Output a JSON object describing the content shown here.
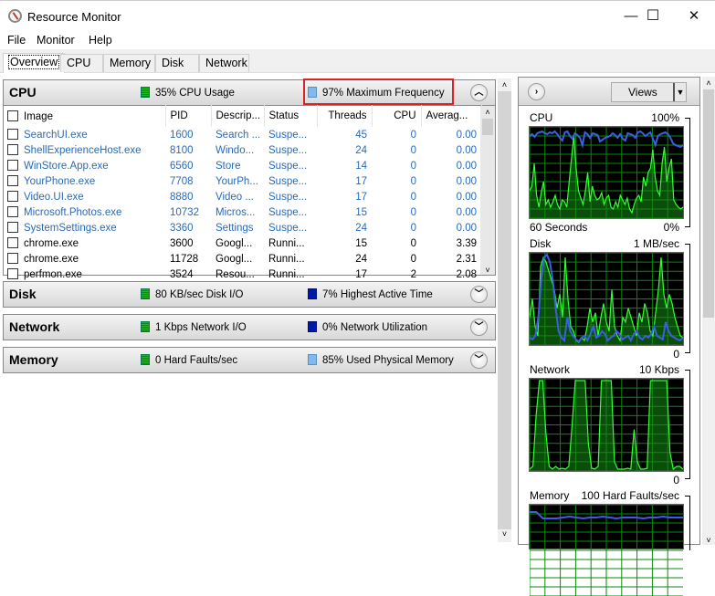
{
  "window": {
    "title": "Resource Monitor",
    "minimize": "—",
    "maximize": "☐",
    "close": "✕"
  },
  "menu": [
    "File",
    "Monitor",
    "Help"
  ],
  "tabs": [
    "Overview",
    "CPU",
    "Memory",
    "Disk",
    "Network"
  ],
  "active_tab": "Overview",
  "cpu_section": {
    "title": "CPU",
    "usage": "35% CPU Usage",
    "frequency": "97% Maximum Frequency",
    "columns": [
      "Image",
      "PID",
      "Descrip...",
      "Status",
      "Threads",
      "CPU",
      "Averag..."
    ],
    "rows": [
      {
        "image": "SearchUI.exe",
        "pid": "1600",
        "desc": "Search ...",
        "status": "Suspe...",
        "threads": "45",
        "cpu": "0",
        "avg": "0.00",
        "suspended": true
      },
      {
        "image": "ShellExperienceHost.exe",
        "pid": "8100",
        "desc": "Windo...",
        "status": "Suspe...",
        "threads": "24",
        "cpu": "0",
        "avg": "0.00",
        "suspended": true
      },
      {
        "image": "WinStore.App.exe",
        "pid": "6560",
        "desc": "Store",
        "status": "Suspe...",
        "threads": "14",
        "cpu": "0",
        "avg": "0.00",
        "suspended": true
      },
      {
        "image": "YourPhone.exe",
        "pid": "7708",
        "desc": "YourPh...",
        "status": "Suspe...",
        "threads": "17",
        "cpu": "0",
        "avg": "0.00",
        "suspended": true
      },
      {
        "image": "Video.UI.exe",
        "pid": "8880",
        "desc": "Video ...",
        "status": "Suspe...",
        "threads": "17",
        "cpu": "0",
        "avg": "0.00",
        "suspended": true
      },
      {
        "image": "Microsoft.Photos.exe",
        "pid": "10732",
        "desc": "Micros...",
        "status": "Suspe...",
        "threads": "15",
        "cpu": "0",
        "avg": "0.00",
        "suspended": true
      },
      {
        "image": "SystemSettings.exe",
        "pid": "3360",
        "desc": "Settings",
        "status": "Suspe...",
        "threads": "24",
        "cpu": "0",
        "avg": "0.00",
        "suspended": true
      },
      {
        "image": "chrome.exe",
        "pid": "3600",
        "desc": "Googl...",
        "status": "Runni...",
        "threads": "15",
        "cpu": "0",
        "avg": "3.39",
        "suspended": false
      },
      {
        "image": "chrome.exe",
        "pid": "11728",
        "desc": "Googl...",
        "status": "Runni...",
        "threads": "24",
        "cpu": "0",
        "avg": "2.31",
        "suspended": false
      },
      {
        "image": "perfmon.exe",
        "pid": "3524",
        "desc": "Resou...",
        "status": "Runni...",
        "threads": "17",
        "cpu": "2",
        "avg": "2.08",
        "suspended": false
      }
    ]
  },
  "disk_section": {
    "title": "Disk",
    "io": "80 KB/sec Disk I/O",
    "active": "7% Highest Active Time"
  },
  "network_section": {
    "title": "Network",
    "io": "1 Kbps Network I/O",
    "util": "0% Network Utilization"
  },
  "memory_section": {
    "title": "Memory",
    "faults": "0 Hard Faults/sec",
    "used": "85% Used Physical Memory"
  },
  "right_panel": {
    "views_label": "Views",
    "cpu_graph": {
      "label": "CPU",
      "max": "100%",
      "min": "0%",
      "time": "60 Seconds"
    },
    "disk_graph": {
      "label": "Disk",
      "max": "1 MB/sec",
      "min": "0"
    },
    "network_graph": {
      "label": "Network",
      "max": "10 Kbps",
      "min": "0"
    },
    "memory_graph": {
      "label": "Memory",
      "max": "100 Hard Faults/sec"
    }
  },
  "colors": {
    "graph_green": "#33ff33",
    "graph_blue": "#3a5fe0",
    "grid": "#0a8a0a",
    "highlight": "#d8232a"
  },
  "graph_series": {
    "cpu_green": [
      30,
      35,
      60,
      25,
      12,
      28,
      40,
      15,
      20,
      12,
      18,
      25,
      15,
      10,
      20,
      18,
      12,
      40,
      65,
      90,
      55,
      30,
      22,
      15,
      30,
      50,
      18,
      35,
      25,
      20,
      22,
      28,
      15,
      22,
      25,
      12,
      10,
      18,
      12,
      25,
      20,
      15,
      22,
      10,
      6,
      15,
      22,
      25,
      18,
      45,
      35,
      50,
      55,
      75,
      45,
      30,
      25,
      60,
      78,
      40,
      55,
      65,
      20,
      15,
      12,
      10,
      12
    ],
    "cpu_blue": [
      90,
      92,
      89,
      93,
      94,
      95,
      93,
      92,
      94,
      93,
      95,
      92,
      88,
      85,
      94,
      95,
      90,
      87,
      93,
      91,
      88,
      80,
      94,
      92,
      88,
      93,
      92,
      91,
      84,
      86,
      88,
      89,
      90,
      93,
      91,
      88,
      92,
      87,
      85,
      93,
      92,
      91,
      88,
      94,
      95,
      93,
      90,
      92,
      94,
      87,
      80,
      90,
      92,
      93,
      94,
      92,
      88,
      82,
      80,
      79,
      78,
      80
    ],
    "disk_green": [
      30,
      50,
      20,
      10,
      85,
      95,
      90,
      80,
      70,
      60,
      40,
      55,
      30,
      95,
      50,
      20,
      15,
      5,
      3,
      8,
      5,
      20,
      40,
      25,
      35,
      10,
      30,
      45,
      25,
      15,
      60,
      20,
      10,
      5,
      30,
      25,
      40,
      30,
      20,
      10,
      35,
      25,
      45,
      35,
      15,
      10,
      35,
      60,
      95,
      55,
      40,
      55,
      45,
      30,
      20,
      10,
      8
    ],
    "disk_blue": [
      8,
      6,
      10,
      30,
      70,
      95,
      98,
      90,
      70,
      40,
      15,
      8,
      5,
      30,
      15,
      10,
      6,
      4,
      8,
      10,
      5,
      12,
      20,
      8,
      10,
      15,
      12,
      5,
      8,
      10,
      15,
      12,
      6,
      8,
      10,
      5,
      12,
      15,
      8,
      6,
      10,
      8,
      12,
      20,
      10,
      8,
      6,
      25,
      15,
      10,
      8,
      6,
      5,
      8
    ],
    "network_green": [
      2,
      5,
      60,
      98,
      98,
      40,
      5,
      2,
      5,
      2,
      3,
      2,
      5,
      50,
      98,
      98,
      98,
      98,
      30,
      3,
      2,
      5,
      98,
      98,
      98,
      98,
      10,
      2,
      2,
      2,
      3,
      2,
      45,
      10,
      2,
      2,
      3,
      98,
      98,
      98,
      98,
      98,
      98,
      20,
      2,
      5,
      5,
      2
    ],
    "memory_blue": [
      92,
      92,
      85,
      85,
      85,
      86,
      87,
      86,
      85,
      86,
      86,
      87,
      86,
      85,
      86,
      86,
      86,
      85,
      86,
      86,
      87,
      86,
      86,
      86
    ]
  }
}
